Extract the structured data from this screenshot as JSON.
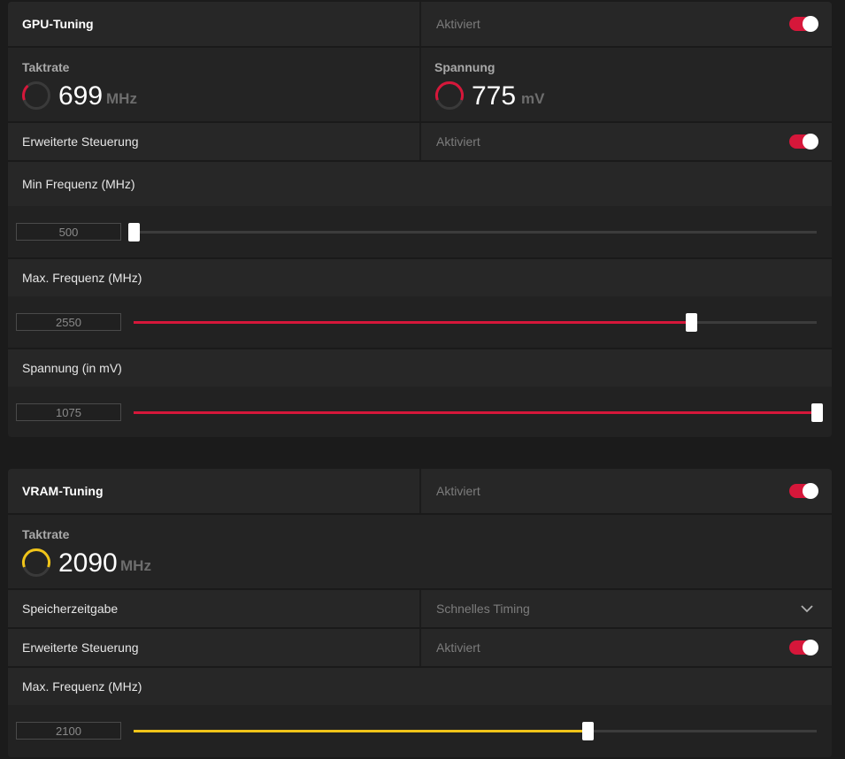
{
  "gpu": {
    "title": "GPU-Tuning",
    "status": "Aktiviert",
    "clock": {
      "label": "Taktrate",
      "value": "699",
      "unit": "MHz",
      "gauge_color": "#d6173a"
    },
    "voltage": {
      "label": "Spannung",
      "value": "775",
      "unit": "mV",
      "gauge_color": "#d6173a"
    },
    "advanced": {
      "label": "Erweiterte Steuerung",
      "status": "Aktiviert"
    },
    "min_freq": {
      "label": "Min Frequenz (MHz)",
      "value": "500",
      "fraction": 0.0
    },
    "max_freq": {
      "label": "Max. Frequenz (MHz)",
      "value": "2550",
      "fraction": 0.816
    },
    "voltage_slider": {
      "label": "Spannung (in mV)",
      "value": "1075",
      "fraction": 1.0
    },
    "accent": "#d6173a"
  },
  "vram": {
    "title": "VRAM-Tuning",
    "status": "Aktiviert",
    "clock": {
      "label": "Taktrate",
      "value": "2090",
      "unit": "MHz",
      "gauge_color": "#f0c419"
    },
    "timing": {
      "label": "Speicherzeitgabe",
      "selected": "Schnelles Timing"
    },
    "advanced": {
      "label": "Erweiterte Steuerung",
      "status": "Aktiviert"
    },
    "max_freq": {
      "label": "Max. Frequenz (MHz)",
      "value": "2100",
      "fraction": 0.664
    },
    "accent": "#f0c419"
  },
  "icons": {
    "toggle": "toggle-on",
    "gauge": "gauge-icon",
    "dropdown": "chevron-down-icon"
  }
}
